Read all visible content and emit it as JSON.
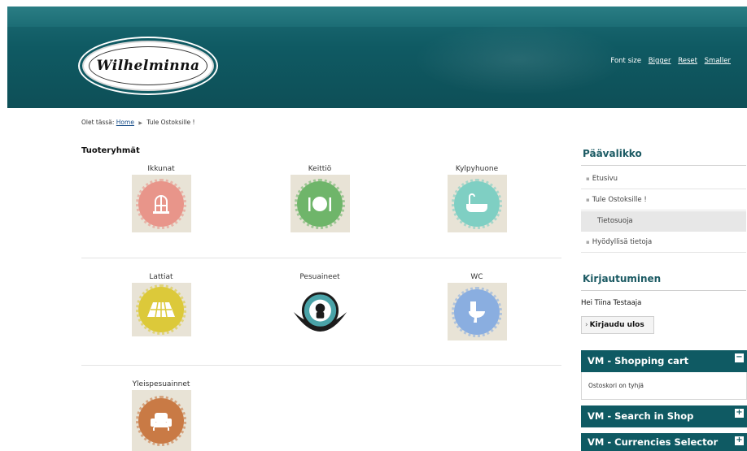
{
  "header": {
    "logo_text": "Wilhelminna",
    "fontsize_label": "Font size",
    "bigger": "Bigger",
    "reset": "Reset",
    "smaller": "Smaller"
  },
  "breadcrumb": {
    "prefix": "Olet tässä:",
    "home": "Home",
    "current": "Tule Ostoksille !"
  },
  "main": {
    "title": "Tuoteryhmät",
    "categories": [
      {
        "label": "Ikkunat",
        "icon": "window-icon",
        "color": "#e8958a"
      },
      {
        "label": "Keittiö",
        "icon": "plate-cutlery-icon",
        "color": "#6fb56a"
      },
      {
        "label": "Kylpyhuone",
        "icon": "bathtub-icon",
        "color": "#7fcfc3"
      },
      {
        "label": "Lattiat",
        "icon": "floor-icon",
        "color": "#dcc93a"
      },
      {
        "label": "Pesuaineet",
        "icon": "brand-emblem-icon",
        "color": "#4aa3a8"
      },
      {
        "label": "WC",
        "icon": "toilet-icon",
        "color": "#8aaee0"
      },
      {
        "label": "Yleispesuainnet",
        "icon": "armchair-icon",
        "color": "#c97a45"
      }
    ]
  },
  "sidebar": {
    "menu_title": "Päävalikko",
    "menu_items": [
      "Etusivu",
      "Tule Ostoksille !",
      "Tietosuoja",
      "Hyödyllisä tietoja"
    ],
    "login_title": "Kirjautuminen",
    "greeting": "Hei Tiina Testaaja",
    "logout": "Kirjaudu ulos",
    "cart_title": "VM - Shopping cart",
    "cart_empty": "Ostoskori on tyhjä",
    "search_title": "VM - Search in Shop",
    "currency_title": "VM - Currencies Selector",
    "toggle_minus": "−",
    "toggle_plus": "+"
  },
  "colors": {
    "header": "#0f5a63",
    "module": "#0f5a63",
    "link": "#1a4f8a"
  }
}
